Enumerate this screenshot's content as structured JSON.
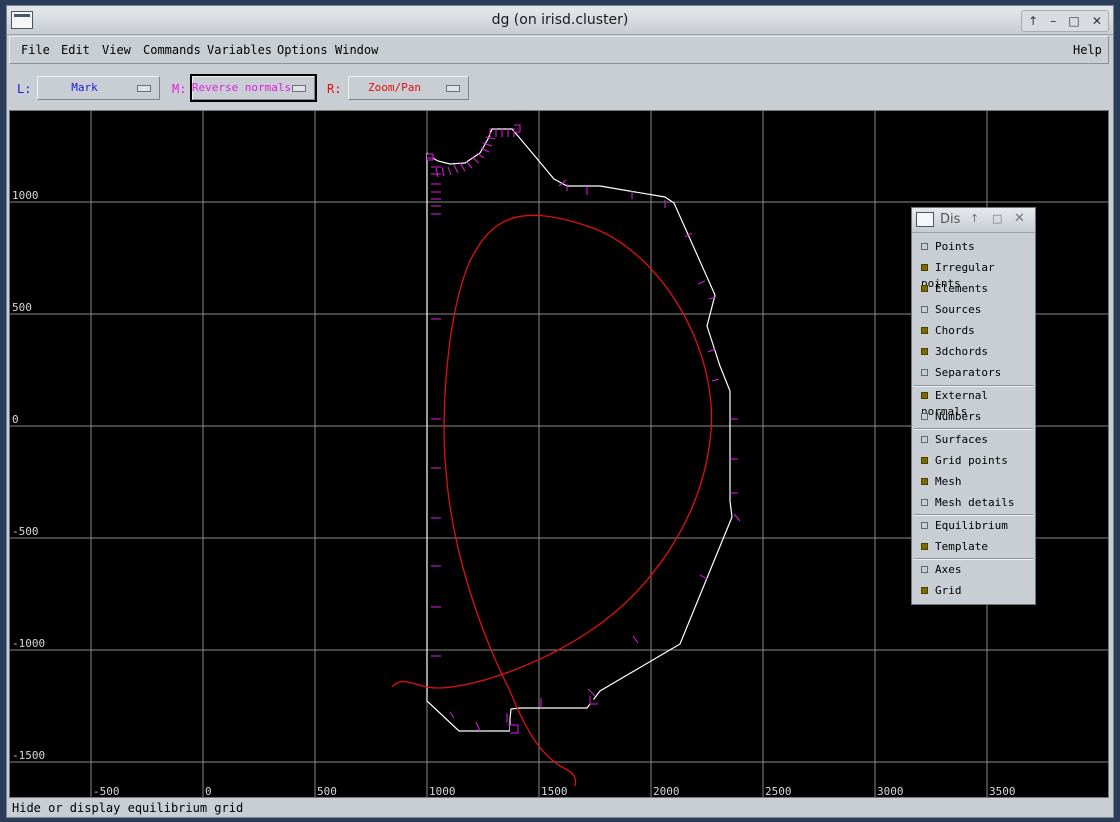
{
  "window": {
    "title": "dg (on irisd.cluster)",
    "buttons": [
      "↑",
      "–",
      "□",
      "✕"
    ]
  },
  "menu": {
    "items": [
      "File",
      "Edit",
      "View",
      "Commands",
      "Variables",
      "Options",
      "Window"
    ],
    "help": "Help"
  },
  "toolbar": {
    "left": {
      "label": "L:",
      "value": "Mark",
      "color": "#1a1ad8"
    },
    "middle": {
      "label": "M:",
      "value": "Reverse normals",
      "color": "#e01ee0"
    },
    "right": {
      "label": "R:",
      "value": "Zoom/Pan",
      "color": "#e01010"
    }
  },
  "plot": {
    "x_ticks": [
      "-500",
      "0",
      "500",
      "1000",
      "1500",
      "2000",
      "2500",
      "3000",
      "3500"
    ],
    "y_ticks": [
      "1000",
      "500",
      "0",
      "-500",
      "-1000",
      "-1500"
    ],
    "wall_color": "#ffffff",
    "normals_color": "#e01ee0",
    "equilibrium_color": "#e01010",
    "grid_color": "#8a8a8a"
  },
  "display_panel": {
    "title": "Dis",
    "buttons": [
      "↑",
      "□",
      "✕"
    ],
    "groups": [
      [
        {
          "label": "Points",
          "on": false
        },
        {
          "label": "Irregular points",
          "on": true
        },
        {
          "label": "Elements",
          "on": true
        },
        {
          "label": "Sources",
          "on": false
        },
        {
          "label": "Chords",
          "on": true
        },
        {
          "label": "3dchords",
          "on": true
        },
        {
          "label": "Separators",
          "on": false
        }
      ],
      [
        {
          "label": "External normals",
          "on": true
        },
        {
          "label": "Numbers",
          "on": false
        }
      ],
      [
        {
          "label": "Surfaces",
          "on": false
        },
        {
          "label": "Grid points",
          "on": true
        },
        {
          "label": "Mesh",
          "on": true
        },
        {
          "label": "Mesh details",
          "on": false
        }
      ],
      [
        {
          "label": "Equilibrium",
          "on": false
        },
        {
          "label": "Template",
          "on": true
        }
      ],
      [
        {
          "label": "Axes",
          "on": false
        },
        {
          "label": "Grid",
          "on": true
        }
      ]
    ]
  },
  "status": "Hide or display equilibrium grid"
}
